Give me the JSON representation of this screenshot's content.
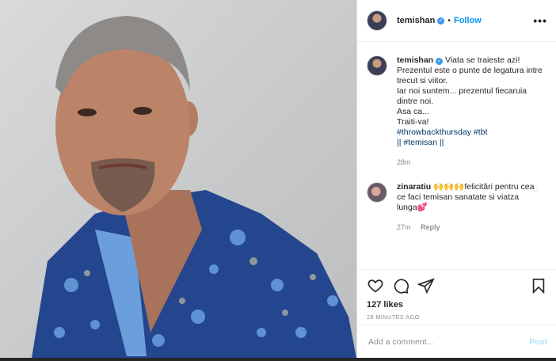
{
  "header": {
    "username": "temishan",
    "dot": "•",
    "follow_label": "Follow",
    "more_label": "•••"
  },
  "caption": {
    "username": "temishan",
    "lines": [
      "Viata se traieste azi!",
      "Prezentul este o punte de legatura intre trecut si viitor.",
      "Iar noi suntem... prezentul fiecaruia dintre noi.",
      "Asa ca...",
      "Traiti-va!"
    ],
    "hashtags": "#throwbackthursday #tbt",
    "handle_line": "|| #temisan ||",
    "time": "28m"
  },
  "comment": {
    "username": "zinaratiu",
    "emoji": "🙌🙌🙌",
    "text": "felicitări pentru cea ce faci temisan sanatate si viatza lunga💕",
    "time": "27m",
    "reply_label": "Reply"
  },
  "actions": {
    "likes": "127 likes",
    "ago": "28 MINUTES AGO"
  },
  "add_comment": {
    "placeholder": "Add a comment...",
    "post_label": "Post"
  },
  "colors": {
    "accent": "#0095f6",
    "verified": "#3897f0",
    "hashtag": "#00376b"
  }
}
